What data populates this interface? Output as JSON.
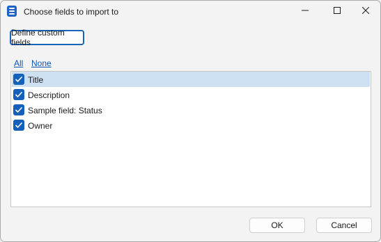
{
  "window": {
    "title": "Choose fields to import to",
    "icon": "database-icon"
  },
  "toolbar": {
    "define_label": "Define custom fields"
  },
  "links": {
    "all": "All",
    "none": "None"
  },
  "fields": [
    {
      "label": "Title",
      "checked": true,
      "selected": true
    },
    {
      "label": "Description",
      "checked": true,
      "selected": false
    },
    {
      "label": "Sample field: Status",
      "checked": true,
      "selected": false
    },
    {
      "label": "Owner",
      "checked": true,
      "selected": false
    }
  ],
  "footer": {
    "ok_label": "OK",
    "cancel_label": "Cancel"
  },
  "colors": {
    "accent": "#1560b8",
    "selection": "#cde0f2",
    "link": "#0a55b8"
  }
}
